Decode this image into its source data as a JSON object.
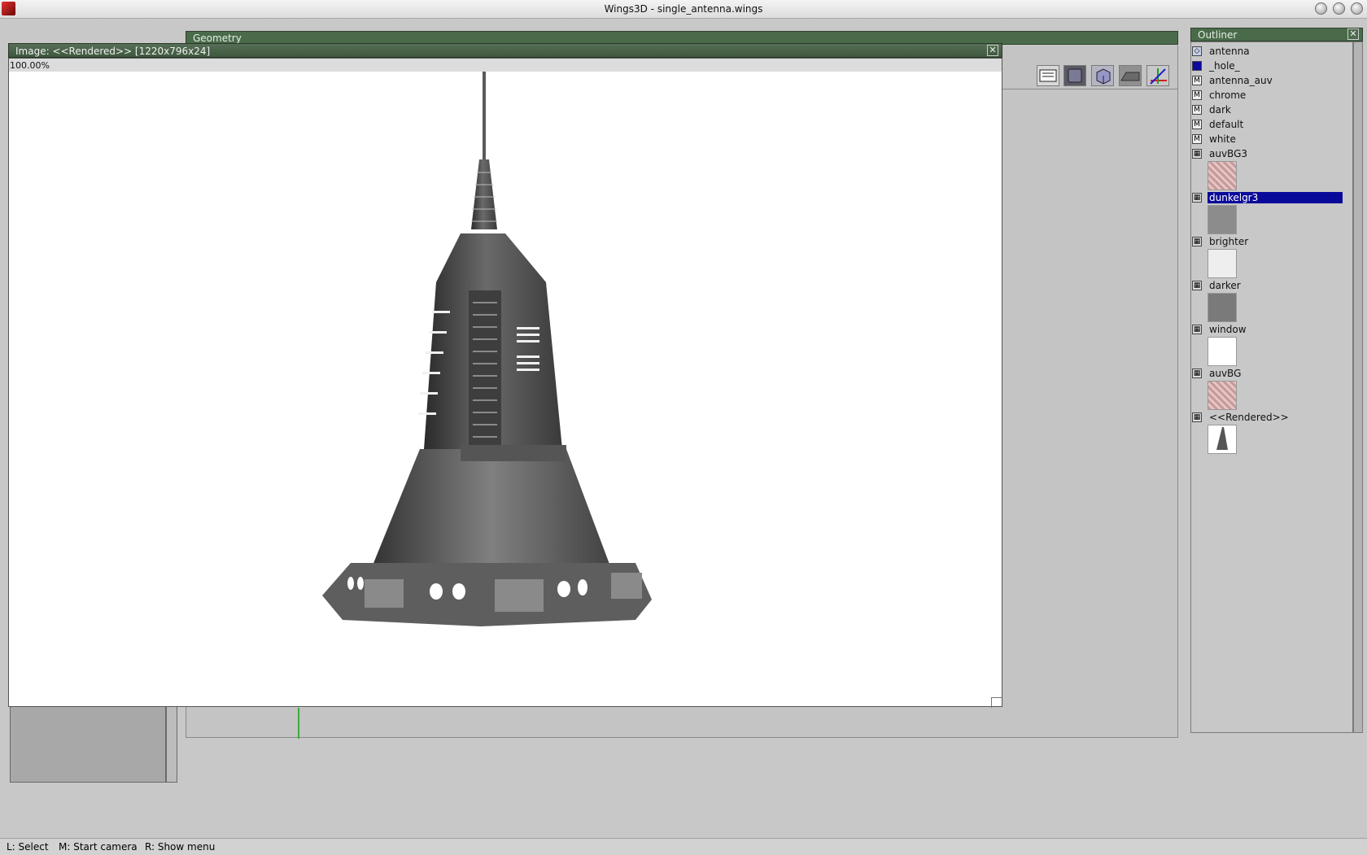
{
  "window": {
    "title": "Wings3D - single_antenna.wings"
  },
  "geometry": {
    "title": "Geometry"
  },
  "image_window": {
    "title": "Image: <<Rendered>> [1220x796x24]",
    "zoom": "100.00%",
    "close": "✕"
  },
  "toolbar": {
    "buttons": [
      "workmode-icon",
      "smooth-shade-icon",
      "wireframe-cube-icon",
      "ground-plane-icon",
      "axes-icon"
    ]
  },
  "outliner": {
    "title": "Outliner",
    "close": "✕",
    "items": [
      {
        "label": "antenna",
        "icon": "object-icon"
      },
      {
        "label": "_hole_",
        "icon": "hole-color-swatch-icon"
      },
      {
        "label": "antenna_auv",
        "icon": "material-icon"
      },
      {
        "label": "chrome",
        "icon": "material-icon"
      },
      {
        "label": "dark",
        "icon": "material-icon"
      },
      {
        "label": "default",
        "icon": "material-icon"
      },
      {
        "label": "white",
        "icon": "material-icon"
      },
      {
        "label": "auvBG3",
        "icon": "image-icon"
      },
      {
        "label": "dunkelgr3",
        "icon": "image-icon",
        "selected": true
      },
      {
        "label": "brighter",
        "icon": "image-icon"
      },
      {
        "label": "darker",
        "icon": "image-icon"
      },
      {
        "label": "window",
        "icon": "image-icon"
      },
      {
        "label": "auvBG",
        "icon": "image-icon"
      },
      {
        "label": "<<Rendered>>",
        "icon": "image-icon"
      }
    ]
  },
  "status": {
    "l": "L: Select",
    "m": "M: Start camera",
    "r": "R: Show menu"
  },
  "colors": {
    "title_green": "#4a6b4a",
    "selection": "#0a0a9a",
    "background": "#c8c8c8"
  }
}
